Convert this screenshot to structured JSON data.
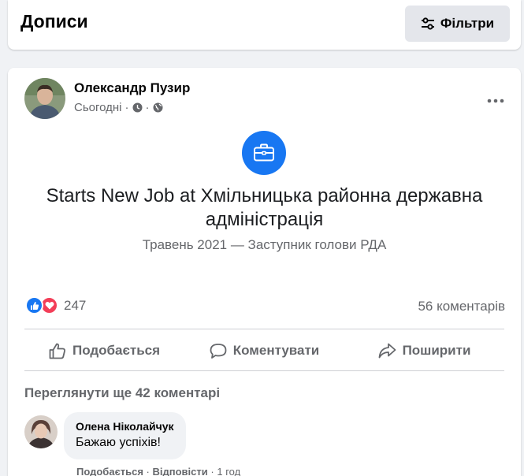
{
  "header": {
    "title": "Дописи",
    "filters_label": "Фільтри"
  },
  "post": {
    "author": "Олександр Пузир",
    "time": "Сьогодні",
    "separator": "·",
    "event_title": "Starts New Job at Хмільницька районна державна адміністрація",
    "event_subtitle": "Травень 2021 — Заступник голови РДА",
    "reaction_count": "247",
    "comments_count": "56 коментарів",
    "actions": {
      "like": "Подобається",
      "comment": "Коментувати",
      "share": "Поширити"
    },
    "view_more_comments": "Переглянути ще 42 коментарі",
    "comment": {
      "author": "Олена Ніколайчук",
      "text": "Бажаю успіхів!",
      "like": "Подобається",
      "reply": "Відповісти",
      "time": "1 год"
    }
  },
  "colors": {
    "accent": "#1877f2",
    "love": "#f33e58",
    "secondary_text": "#65676b",
    "background": "#f0f2f5"
  },
  "icons": {
    "filters": "sliders-icon",
    "clock": "clock-icon",
    "globe": "globe-icon",
    "more": "more-dots-icon",
    "event": "briefcase-icon",
    "like_reaction": "like-reaction-icon",
    "love_reaction": "love-reaction-icon",
    "like_action": "thumbs-up-icon",
    "comment_action": "comment-icon",
    "share_action": "share-icon"
  }
}
